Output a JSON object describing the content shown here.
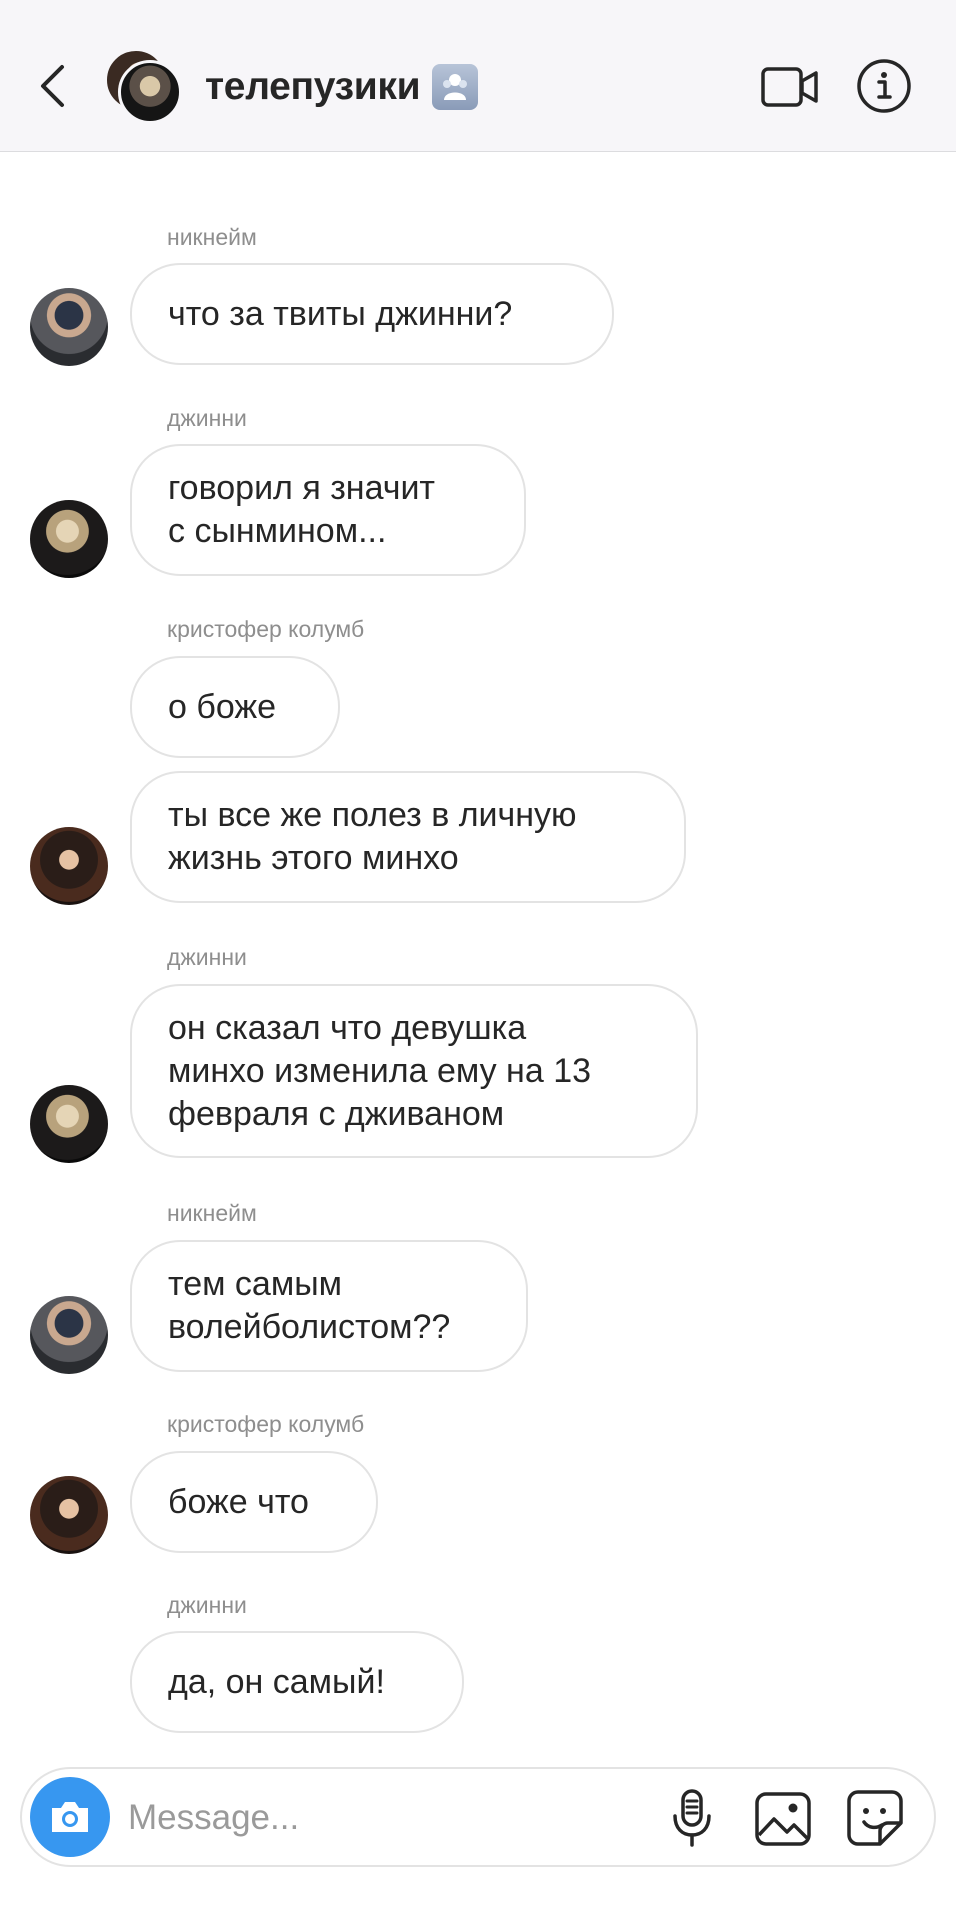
{
  "header": {
    "title": "телепузики",
    "icons": {
      "back": "chevron-left-icon",
      "group": "group-emoji-icon",
      "video": "video-camera-icon",
      "info": "info-icon"
    }
  },
  "messages": [
    {
      "sender": "никнейм",
      "text": "что за твиты джинни?",
      "avatar": "avatar-a"
    },
    {
      "sender": "джинни",
      "text": "говорил я значит\nс сынмином...",
      "avatar": "avatar-b"
    },
    {
      "sender": "кристофер колумб",
      "text": "о боже",
      "avatar": ""
    },
    {
      "sender": "",
      "text": "ты все же полез в личную\nжизнь этого минхо",
      "avatar": "avatar-c"
    },
    {
      "sender": "джинни",
      "text": "он сказал что девушка\nминхо изменила ему на 13\nфевраля с дживаном",
      "avatar": "avatar-b"
    },
    {
      "sender": "никнейм",
      "text": "тем самым\nволейболистом??",
      "avatar": "avatar-a"
    },
    {
      "sender": "кристофер колумб",
      "text": "боже что",
      "avatar": "avatar-c"
    },
    {
      "sender": "джинни",
      "text": "да, он самый!",
      "avatar": ""
    }
  ],
  "composer": {
    "placeholder": "Message...",
    "accent_color": "#3797f0",
    "icons": {
      "camera": "camera-icon",
      "mic": "microphone-icon",
      "gallery": "gallery-icon",
      "sticker": "sticker-icon"
    }
  }
}
